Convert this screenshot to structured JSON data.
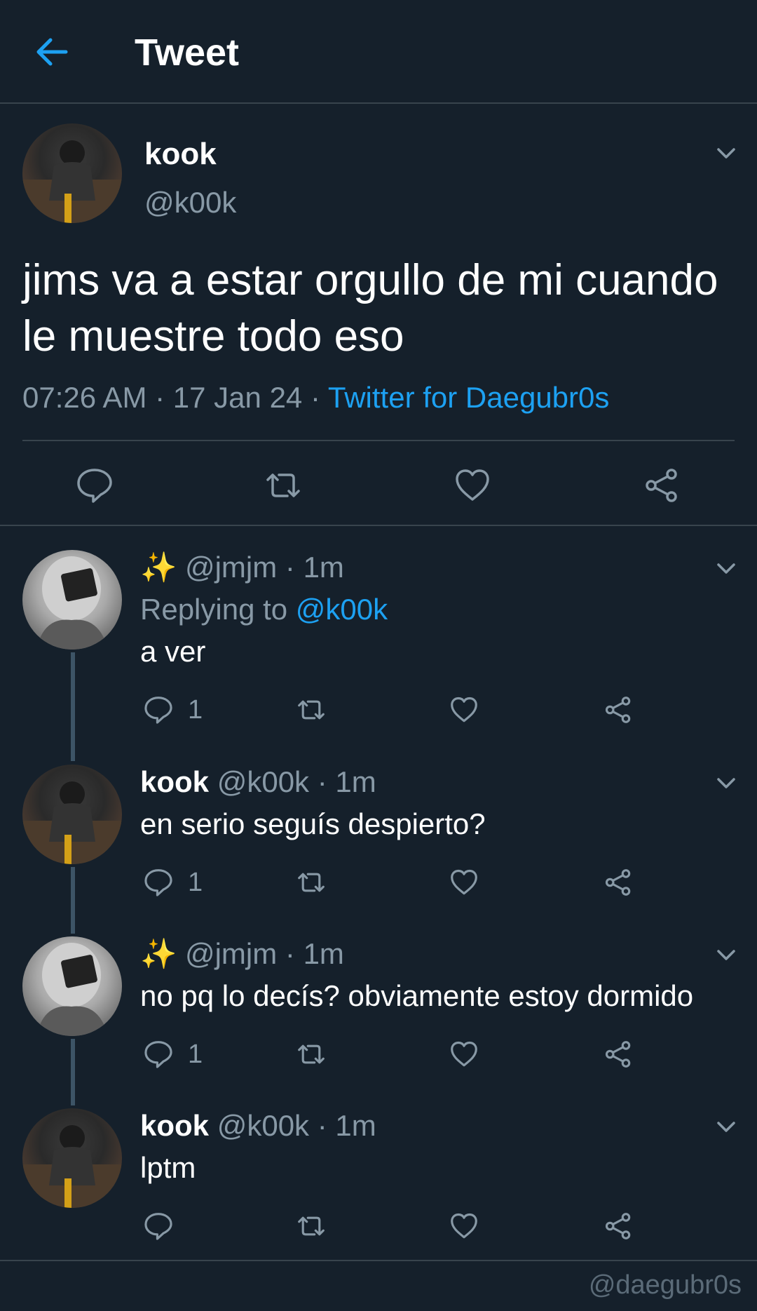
{
  "header": {
    "title": "Tweet",
    "back_icon": "arrow-left-icon"
  },
  "colors": {
    "background": "#15202b",
    "accent": "#1da1f2",
    "muted": "#8899a6",
    "divider": "#38444d"
  },
  "main_tweet": {
    "name": "kook",
    "handle": "@k00k",
    "text": "jims va a estar orgullo de mi cuando le muestre todo eso",
    "time": "07:26 AM",
    "date": "17 Jan 24",
    "source": "Twitter for Daegubr0s",
    "sep": " · "
  },
  "replies": [
    {
      "prefix": "✨",
      "name": "",
      "handle": "@jmjm",
      "time": "1m",
      "replying_label": "Replying to",
      "replying_to": "@k00k",
      "text": "a ver",
      "reply_count": "1"
    },
    {
      "prefix": "",
      "name": "kook",
      "handle": "@k00k",
      "time": "1m",
      "text": "en serio seguís despierto?",
      "reply_count": "1"
    },
    {
      "prefix": "✨",
      "name": "",
      "handle": "@jmjm",
      "time": "1m",
      "text": "no pq lo decís? obviamente estoy dormido",
      "reply_count": "1"
    },
    {
      "prefix": "",
      "name": "kook",
      "handle": "@k00k",
      "time": "1m",
      "text": "lptm",
      "reply_count": ""
    }
  ],
  "watermark": "@daegubr0s"
}
